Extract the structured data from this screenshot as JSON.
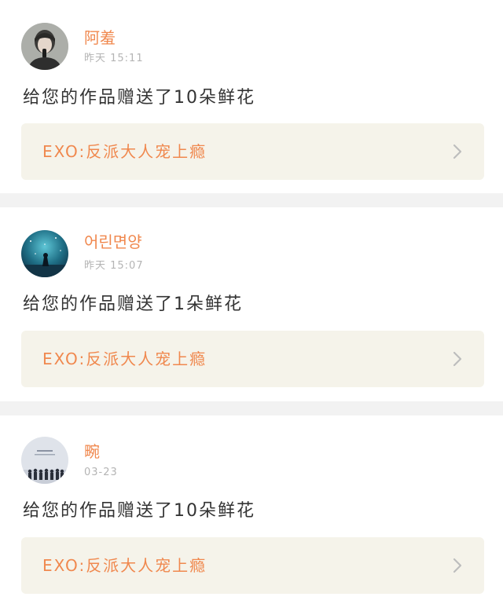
{
  "notifications": [
    {
      "username": "阿羞",
      "time": "昨天 15:11",
      "avatar_icon": "avatar-singer-photo",
      "message": "给您的作品赠送了10朵鲜花",
      "work_title": "EXO:反派大人宠上瘾"
    },
    {
      "username": "어린면양",
      "time": "昨天 15:07",
      "avatar_icon": "avatar-starry-night",
      "message": "给您的作品赠送了1朵鲜花",
      "work_title": "EXO:反派大人宠上瘾"
    },
    {
      "username": "畹",
      "time": "03-23",
      "avatar_icon": "avatar-group-photo",
      "message": "给您的作品赠送了10朵鲜花",
      "work_title": "EXO:反派大人宠上瘾"
    }
  ],
  "icons": {
    "chevron": "chevron-right-icon"
  },
  "colors": {
    "accent": "#f0884e",
    "card_background": "#ffffff",
    "page_background": "#f2f2f2",
    "link_background": "#f5f3ea",
    "timestamp": "#b4b4b4",
    "message_text": "#333333"
  }
}
